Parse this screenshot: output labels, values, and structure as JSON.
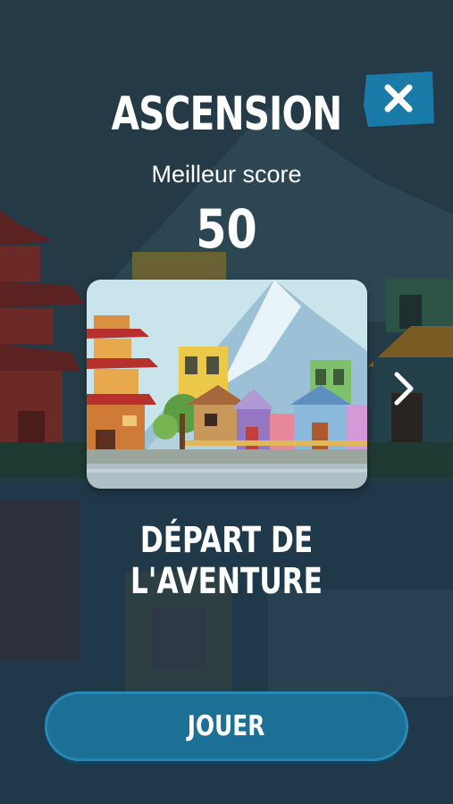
{
  "game": {
    "title": "ASCENSION",
    "best_score_label": "Meilleur score",
    "best_score_value": "50",
    "level_name": "DÉPART DE L'AVENTURE",
    "play_label": "JOUER"
  },
  "icons": {
    "close": "close-icon",
    "next": "chevron-right-icon"
  },
  "colors": {
    "background": "#213843",
    "button": "#1c6f95",
    "close_button": "#1a7aa8"
  }
}
